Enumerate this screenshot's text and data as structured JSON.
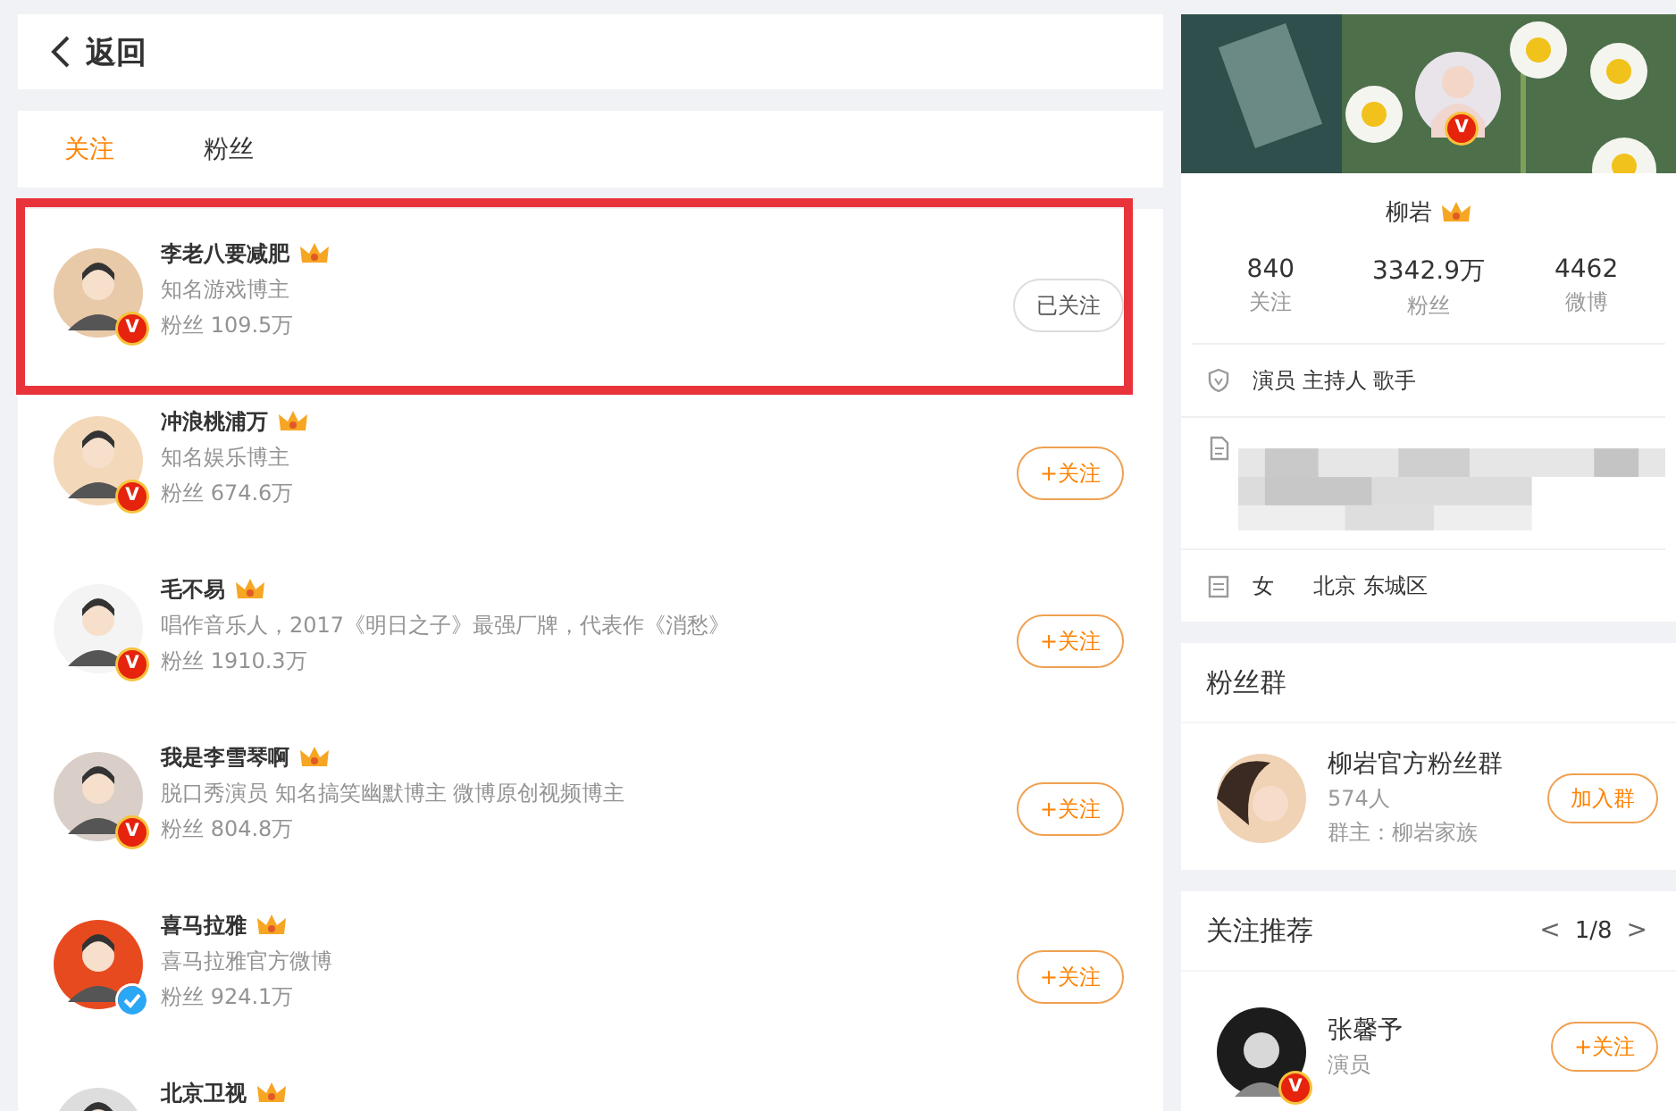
{
  "back": {
    "label": "返回"
  },
  "tabs": [
    {
      "label": "关注",
      "selected": true
    },
    {
      "label": "粉丝",
      "selected": false
    }
  ],
  "users": [
    {
      "name": "李老八要减肥",
      "desc": "知名游戏博主",
      "fans": "粉丝 109.5万",
      "badge": {
        "kind": "gold",
        "text": "V"
      },
      "button": "已关注",
      "followed": true,
      "highlighted": true
    },
    {
      "name": "冲浪桃浦万",
      "desc": "知名娱乐博主",
      "fans": "粉丝 674.6万",
      "badge": {
        "kind": "gold",
        "text": "V"
      },
      "button": "+关注",
      "followed": false,
      "highlighted": false
    },
    {
      "name": "毛不易",
      "desc": "唱作音乐人，2017《明日之子》最强厂牌，代表作《消愁》",
      "fans": "粉丝 1910.3万",
      "badge": {
        "kind": "gold",
        "text": "V"
      },
      "button": "+关注",
      "followed": false,
      "highlighted": false
    },
    {
      "name": "我是李雪琴啊",
      "desc": "脱口秀演员 知名搞笑幽默博主 微博原创视频博主",
      "fans": "粉丝 804.8万",
      "badge": {
        "kind": "gold",
        "text": "V"
      },
      "button": "+关注",
      "followed": false,
      "highlighted": false
    },
    {
      "name": "喜马拉雅",
      "desc": "喜马拉雅官方微博",
      "fans": "粉丝 924.1万",
      "badge": {
        "kind": "blue"
      },
      "button": "+关注",
      "followed": false,
      "highlighted": false
    },
    {
      "name": "北京卫视",
      "highlighted": false
    }
  ],
  "profile": {
    "name": "柳岩",
    "badge": {
      "kind": "gold",
      "text": "V"
    },
    "stats": [
      {
        "value": "840",
        "label": "关注"
      },
      {
        "value": "3342.9万",
        "label": "粉丝"
      },
      {
        "value": "4462",
        "label": "微博"
      }
    ],
    "details": [
      {
        "kind": "tags",
        "text": "演员 主持人 歌手"
      },
      {
        "kind": "redacted"
      },
      {
        "kind": "location",
        "parts": [
          "女",
          "北京 东城区"
        ]
      }
    ]
  },
  "fan_group": {
    "title": "粉丝群",
    "name": "柳岩官方粉丝群",
    "count": "574人",
    "owner": "群主：柳岩家族",
    "button": "加入群"
  },
  "recommend": {
    "title": "关注推荐",
    "prev": "<",
    "page": "1/8",
    "next": ">",
    "items": [
      {
        "name": "张馨予",
        "desc": "演员",
        "badge": {
          "kind": "gold",
          "text": "V"
        },
        "button": "+关注"
      }
    ]
  }
}
